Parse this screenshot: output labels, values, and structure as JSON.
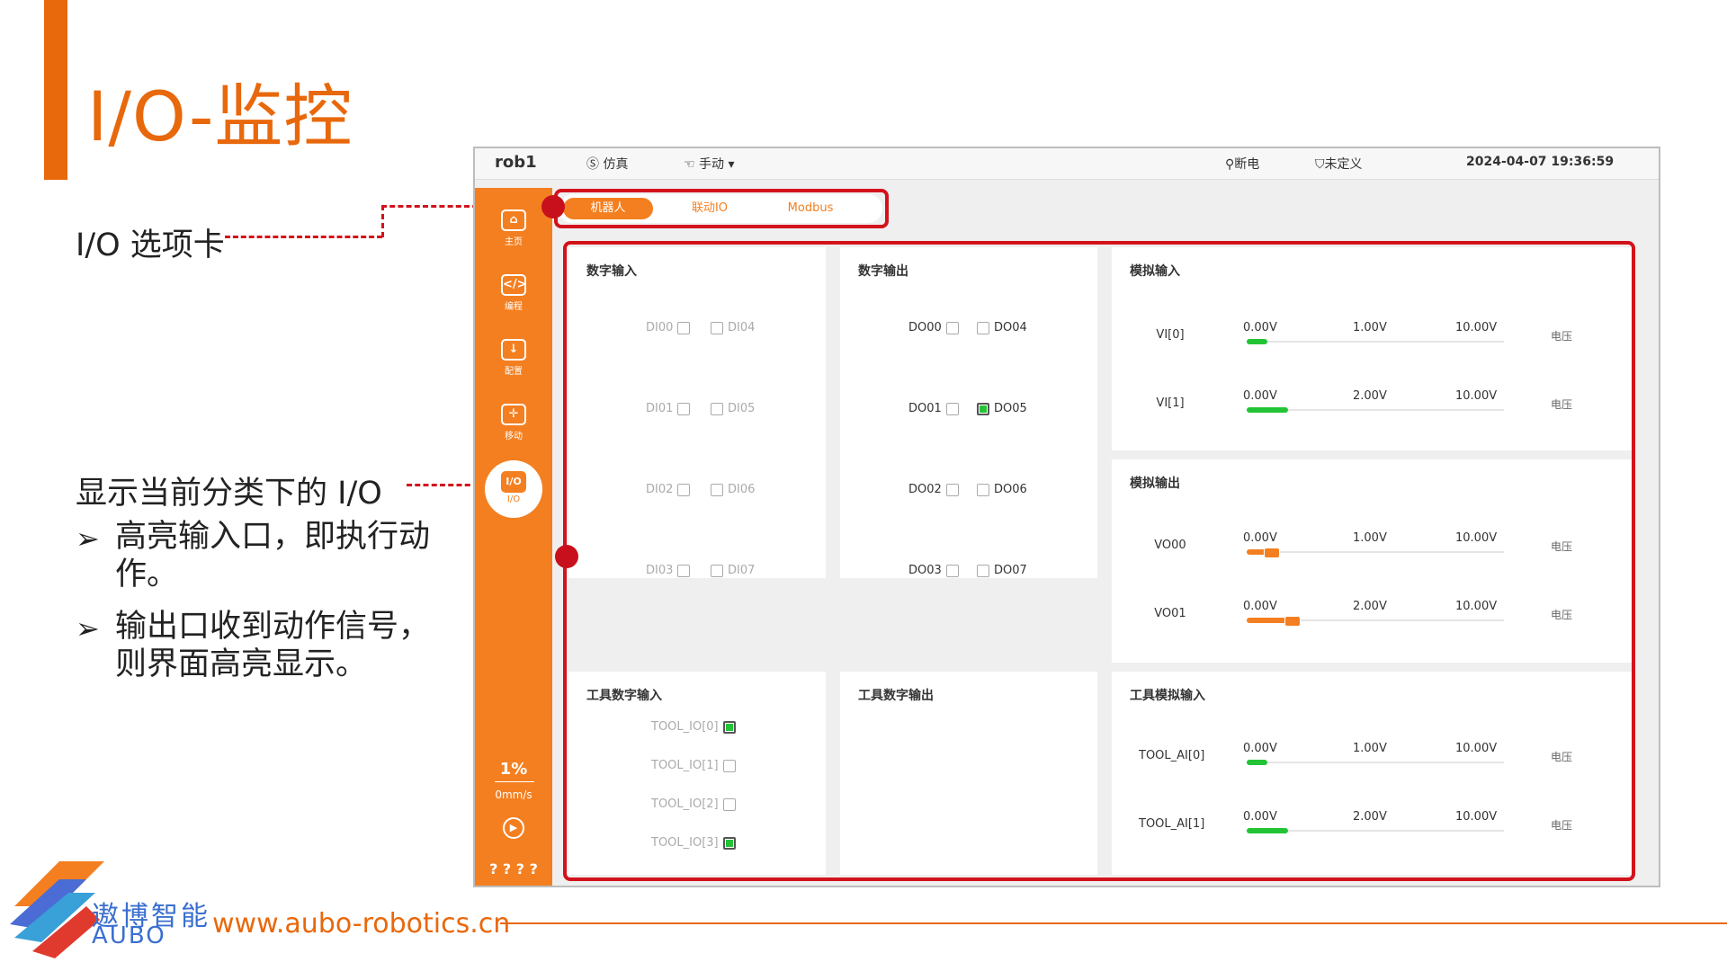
{
  "slide": {
    "title": "I/O-监控",
    "note_tab": "I/O 选项卡",
    "note_display": "显示当前分类下的 I/O",
    "bullets": [
      "高亮输入口，即执行动作。",
      "输出口收到动作信号，则界面高亮显示。"
    ],
    "bullet_arrow": "➢",
    "logo_cn": "遨博智能",
    "logo_en": "AUBO",
    "url": "www.aubo-robotics.cn",
    "accent_color": "#e8680c"
  },
  "app": {
    "robot_name": "rob1",
    "mode_sim": "仿真",
    "mode_manual": "手动",
    "power": "断电",
    "safety": "未定义",
    "datetime": "2024-04-07 19:36:59",
    "icons": {
      "sim": "simulation-icon",
      "manual": "hand-icon",
      "power": "robot-arm-icon",
      "safety": "shield-icon"
    },
    "sidebar": {
      "items": [
        {
          "label": "主页",
          "icon": "home-icon"
        },
        {
          "label": "编程",
          "icon": "code-icon"
        },
        {
          "label": "配置",
          "icon": "download-icon"
        },
        {
          "label": "移动",
          "icon": "move-icon"
        }
      ],
      "active": {
        "label": "I/O",
        "glyph": "I/O"
      },
      "speed_percent": "1%",
      "speed": "0mm/s",
      "footer": "? ? ? ?"
    },
    "tabs": [
      "机器人",
      "联动IO",
      "Modbus"
    ],
    "active_tab": "机器人",
    "brand_color": "#f47f20",
    "on_color": "#22c435",
    "digital_input": {
      "title": "数字输入",
      "left": [
        {
          "name": "DI00",
          "on": false
        },
        {
          "name": "DI01",
          "on": false
        },
        {
          "name": "DI02",
          "on": false
        },
        {
          "name": "DI03",
          "on": false
        }
      ],
      "right": [
        {
          "name": "DI04",
          "on": false
        },
        {
          "name": "DI05",
          "on": false
        },
        {
          "name": "DI06",
          "on": false
        },
        {
          "name": "DI07",
          "on": false
        }
      ]
    },
    "digital_output": {
      "title": "数字输出",
      "left": [
        {
          "name": "DO00",
          "on": false
        },
        {
          "name": "DO01",
          "on": false
        },
        {
          "name": "DO02",
          "on": false
        },
        {
          "name": "DO03",
          "on": false
        }
      ],
      "right": [
        {
          "name": "DO04",
          "on": false
        },
        {
          "name": "DO05",
          "on": true
        },
        {
          "name": "DO06",
          "on": false
        },
        {
          "name": "DO07",
          "on": false
        }
      ]
    },
    "analog_input": {
      "title": "模拟输入",
      "rows": [
        {
          "name": "VI[0]",
          "v0": "0.00V",
          "v1": "1.00V",
          "v2": "10.00V",
          "unit": "电压",
          "level": 0.08
        },
        {
          "name": "VI[1]",
          "v0": "0.00V",
          "v1": "2.00V",
          "v2": "10.00V",
          "unit": "电压",
          "level": 0.16
        }
      ]
    },
    "analog_output": {
      "title": "模拟输出",
      "rows": [
        {
          "name": "VO00",
          "v0": "0.00V",
          "v1": "1.00V",
          "v2": "10.00V",
          "unit": "电压",
          "level": 0.11
        },
        {
          "name": "VO01",
          "v0": "0.00V",
          "v1": "2.00V",
          "v2": "10.00V",
          "unit": "电压",
          "level": 0.19
        }
      ]
    },
    "tool_digital_input": {
      "title": "工具数字输入",
      "items": [
        {
          "name": "TOOL_IO[0]",
          "on": true
        },
        {
          "name": "TOOL_IO[1]",
          "on": false
        },
        {
          "name": "TOOL_IO[2]",
          "on": false
        },
        {
          "name": "TOOL_IO[3]",
          "on": true
        }
      ]
    },
    "tool_digital_output": {
      "title": "工具数字输出"
    },
    "tool_analog_input": {
      "title": "工具模拟输入",
      "rows": [
        {
          "name": "TOOL_AI[0]",
          "v0": "0.00V",
          "v1": "1.00V",
          "v2": "10.00V",
          "unit": "电压",
          "level": 0.08
        },
        {
          "name": "TOOL_AI[1]",
          "v0": "0.00V",
          "v1": "2.00V",
          "v2": "10.00V",
          "unit": "电压",
          "level": 0.16
        }
      ]
    }
  }
}
